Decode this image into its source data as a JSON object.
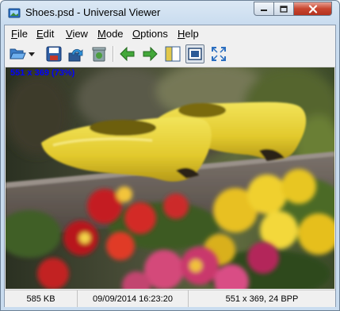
{
  "window": {
    "title": "Shoes.psd - Universal Viewer",
    "title_bar_color": "#c9dcef",
    "close_button_color": "#c8452f"
  },
  "menu": [
    {
      "label": "File",
      "accel": "F",
      "rest": "ile"
    },
    {
      "label": "Edit",
      "accel": "E",
      "rest": "dit"
    },
    {
      "label": "View",
      "accel": "V",
      "rest": "iew"
    },
    {
      "label": "Mode",
      "accel": "M",
      "rest": "ode"
    },
    {
      "label": "Options",
      "accel": "O",
      "rest": "ptions"
    },
    {
      "label": "Help",
      "accel": "H",
      "rest": "elp"
    }
  ],
  "toolbar": {
    "buttons": [
      {
        "name": "open-folder",
        "icon": "folder-open-icon",
        "has_dropdown": true
      },
      {
        "name": "save",
        "icon": "floppy-disk-icon"
      },
      {
        "name": "reload",
        "icon": "reload-icon"
      },
      {
        "name": "delete",
        "icon": "recycle-bin-icon"
      },
      {
        "name": "previous",
        "icon": "arrow-left-icon"
      },
      {
        "name": "next",
        "icon": "arrow-right-icon"
      },
      {
        "name": "panel",
        "icon": "side-panel-icon"
      },
      {
        "name": "fit-window",
        "icon": "fit-window-icon",
        "pressed": true
      },
      {
        "name": "fullscreen",
        "icon": "fullscreen-icon"
      }
    ]
  },
  "viewer": {
    "dimension_overlay": "551 x 369 (73%)",
    "overlay_color": "#0000ff"
  },
  "status": {
    "file_size": "585 KB",
    "date": "09/09/2014 16:23:20",
    "image_info": "551 x 369, 24 BPP"
  }
}
